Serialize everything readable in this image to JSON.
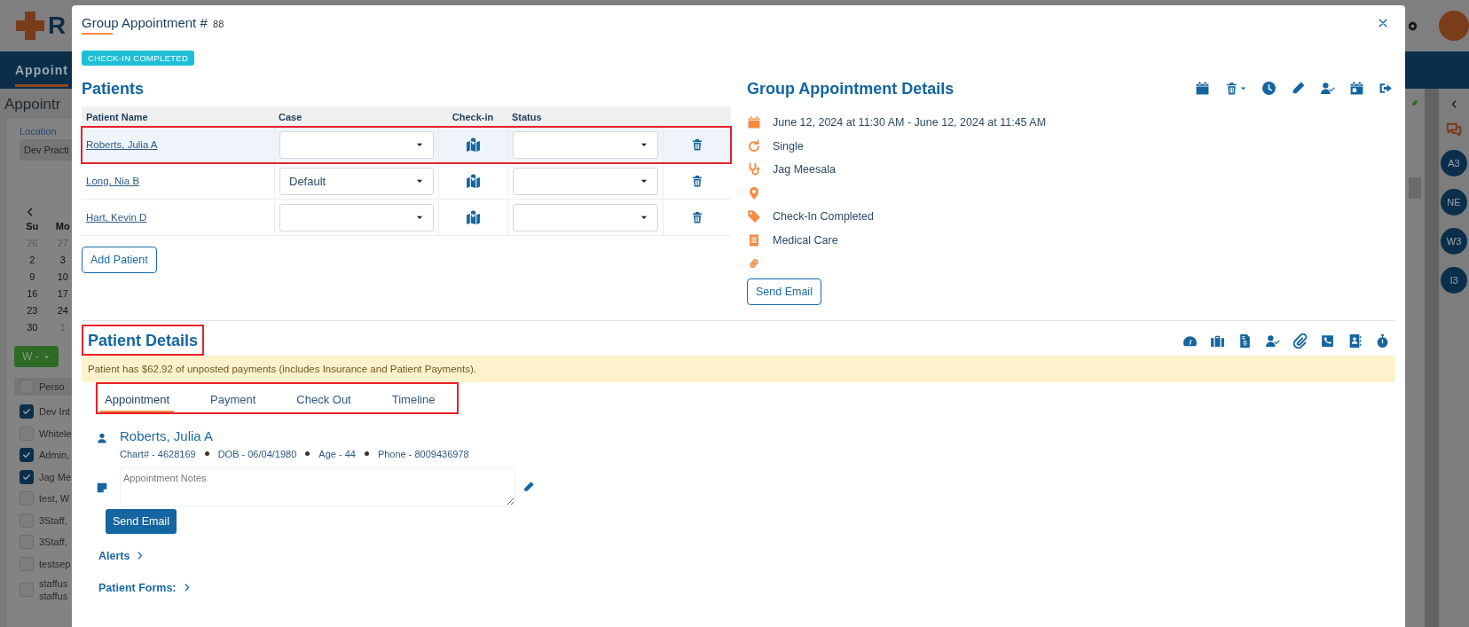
{
  "background": {
    "logo_text": "R",
    "nav_tab": "Appoint",
    "page_title": "Appointr",
    "location_label": "Location",
    "location_value": "Dev Practi",
    "calendar": {
      "weekdays": [
        "Su",
        "Mo"
      ],
      "weeks": [
        [
          {
            "day": "26",
            "muted": true
          },
          {
            "day": "27",
            "muted": true
          }
        ],
        [
          {
            "day": "2",
            "muted": false
          },
          {
            "day": "3",
            "muted": false
          }
        ],
        [
          {
            "day": "9",
            "muted": false
          },
          {
            "day": "10",
            "muted": false
          }
        ],
        [
          {
            "day": "16",
            "muted": false
          },
          {
            "day": "17",
            "muted": false
          }
        ],
        [
          {
            "day": "23",
            "muted": false
          },
          {
            "day": "24",
            "muted": false
          }
        ],
        [
          {
            "day": "30",
            "muted": false
          },
          {
            "day": "1",
            "muted": true
          }
        ]
      ]
    },
    "view_button": "W -",
    "staff_header": {
      "label": "Perso",
      "checked": false
    },
    "staff": [
      {
        "label": "Dev Int",
        "checked": true
      },
      {
        "label": "Whitele",
        "checked": false
      },
      {
        "label": "Admin,",
        "checked": true
      },
      {
        "label": "Jag Me",
        "checked": true
      },
      {
        "label": "test, W",
        "checked": false
      },
      {
        "label": "3Staff,",
        "checked": false
      },
      {
        "label": "3Staff,",
        "checked": false
      },
      {
        "label": "testsep",
        "checked": false
      },
      {
        "label": "staffus staffus",
        "checked": false
      }
    ],
    "sidebar_avatars": [
      "A3",
      "NE",
      "W3",
      "I3"
    ]
  },
  "modal": {
    "title": "Group Appointment #",
    "number": "88",
    "badge": "CHECK-IN COMPLETED"
  },
  "patients": {
    "heading": "Patients",
    "columns": [
      "Patient Name",
      "Case",
      "Check-in",
      "Status"
    ],
    "rows": [
      {
        "name": "Roberts, Julia A",
        "selected": true,
        "highlighted": true
      },
      {
        "name": "Long, Nia B",
        "case": "Default",
        "selected": false,
        "highlighted": false
      },
      {
        "name": "Hart, Kevin D",
        "selected": false,
        "highlighted": false
      }
    ],
    "add_button": "Add Patient"
  },
  "details": {
    "heading": "Group Appointment Details",
    "lines": [
      {
        "kind": "datetime",
        "text": "June 12, 2024 at 11:30 AM - June 12, 2024 at 11:45 AM"
      },
      {
        "kind": "repeat",
        "text": "Single"
      },
      {
        "kind": "provider",
        "text": "Jag Meesala"
      },
      {
        "kind": "location"
      },
      {
        "kind": "status",
        "text": "Check-In Completed"
      },
      {
        "kind": "type",
        "text": "Medical Care"
      },
      {
        "kind": "link"
      }
    ],
    "email_button": "Send Email"
  },
  "patient_details": {
    "heading": "Patient Details",
    "heading_highlighted": true,
    "alert": "Patient has $62.92 of unposted payments (includes Insurance and Patient Payments).",
    "tabs_highlighted": true,
    "tabs": [
      {
        "label": "Appointment",
        "selected": true
      },
      {
        "label": "Payment",
        "selected": false
      },
      {
        "label": "Check Out",
        "selected": false
      },
      {
        "label": "Timeline",
        "selected": false
      }
    ],
    "name": "Roberts, Julia A",
    "meta": [
      "Chart# - 4628169",
      "DOB - 06/04/1980",
      "Age - 44",
      "Phone - 8009436978"
    ],
    "notes_placeholder": "Appointment Notes",
    "email_button": "Send Email",
    "sections": [
      "Alerts",
      "Patient Forms:"
    ]
  }
}
